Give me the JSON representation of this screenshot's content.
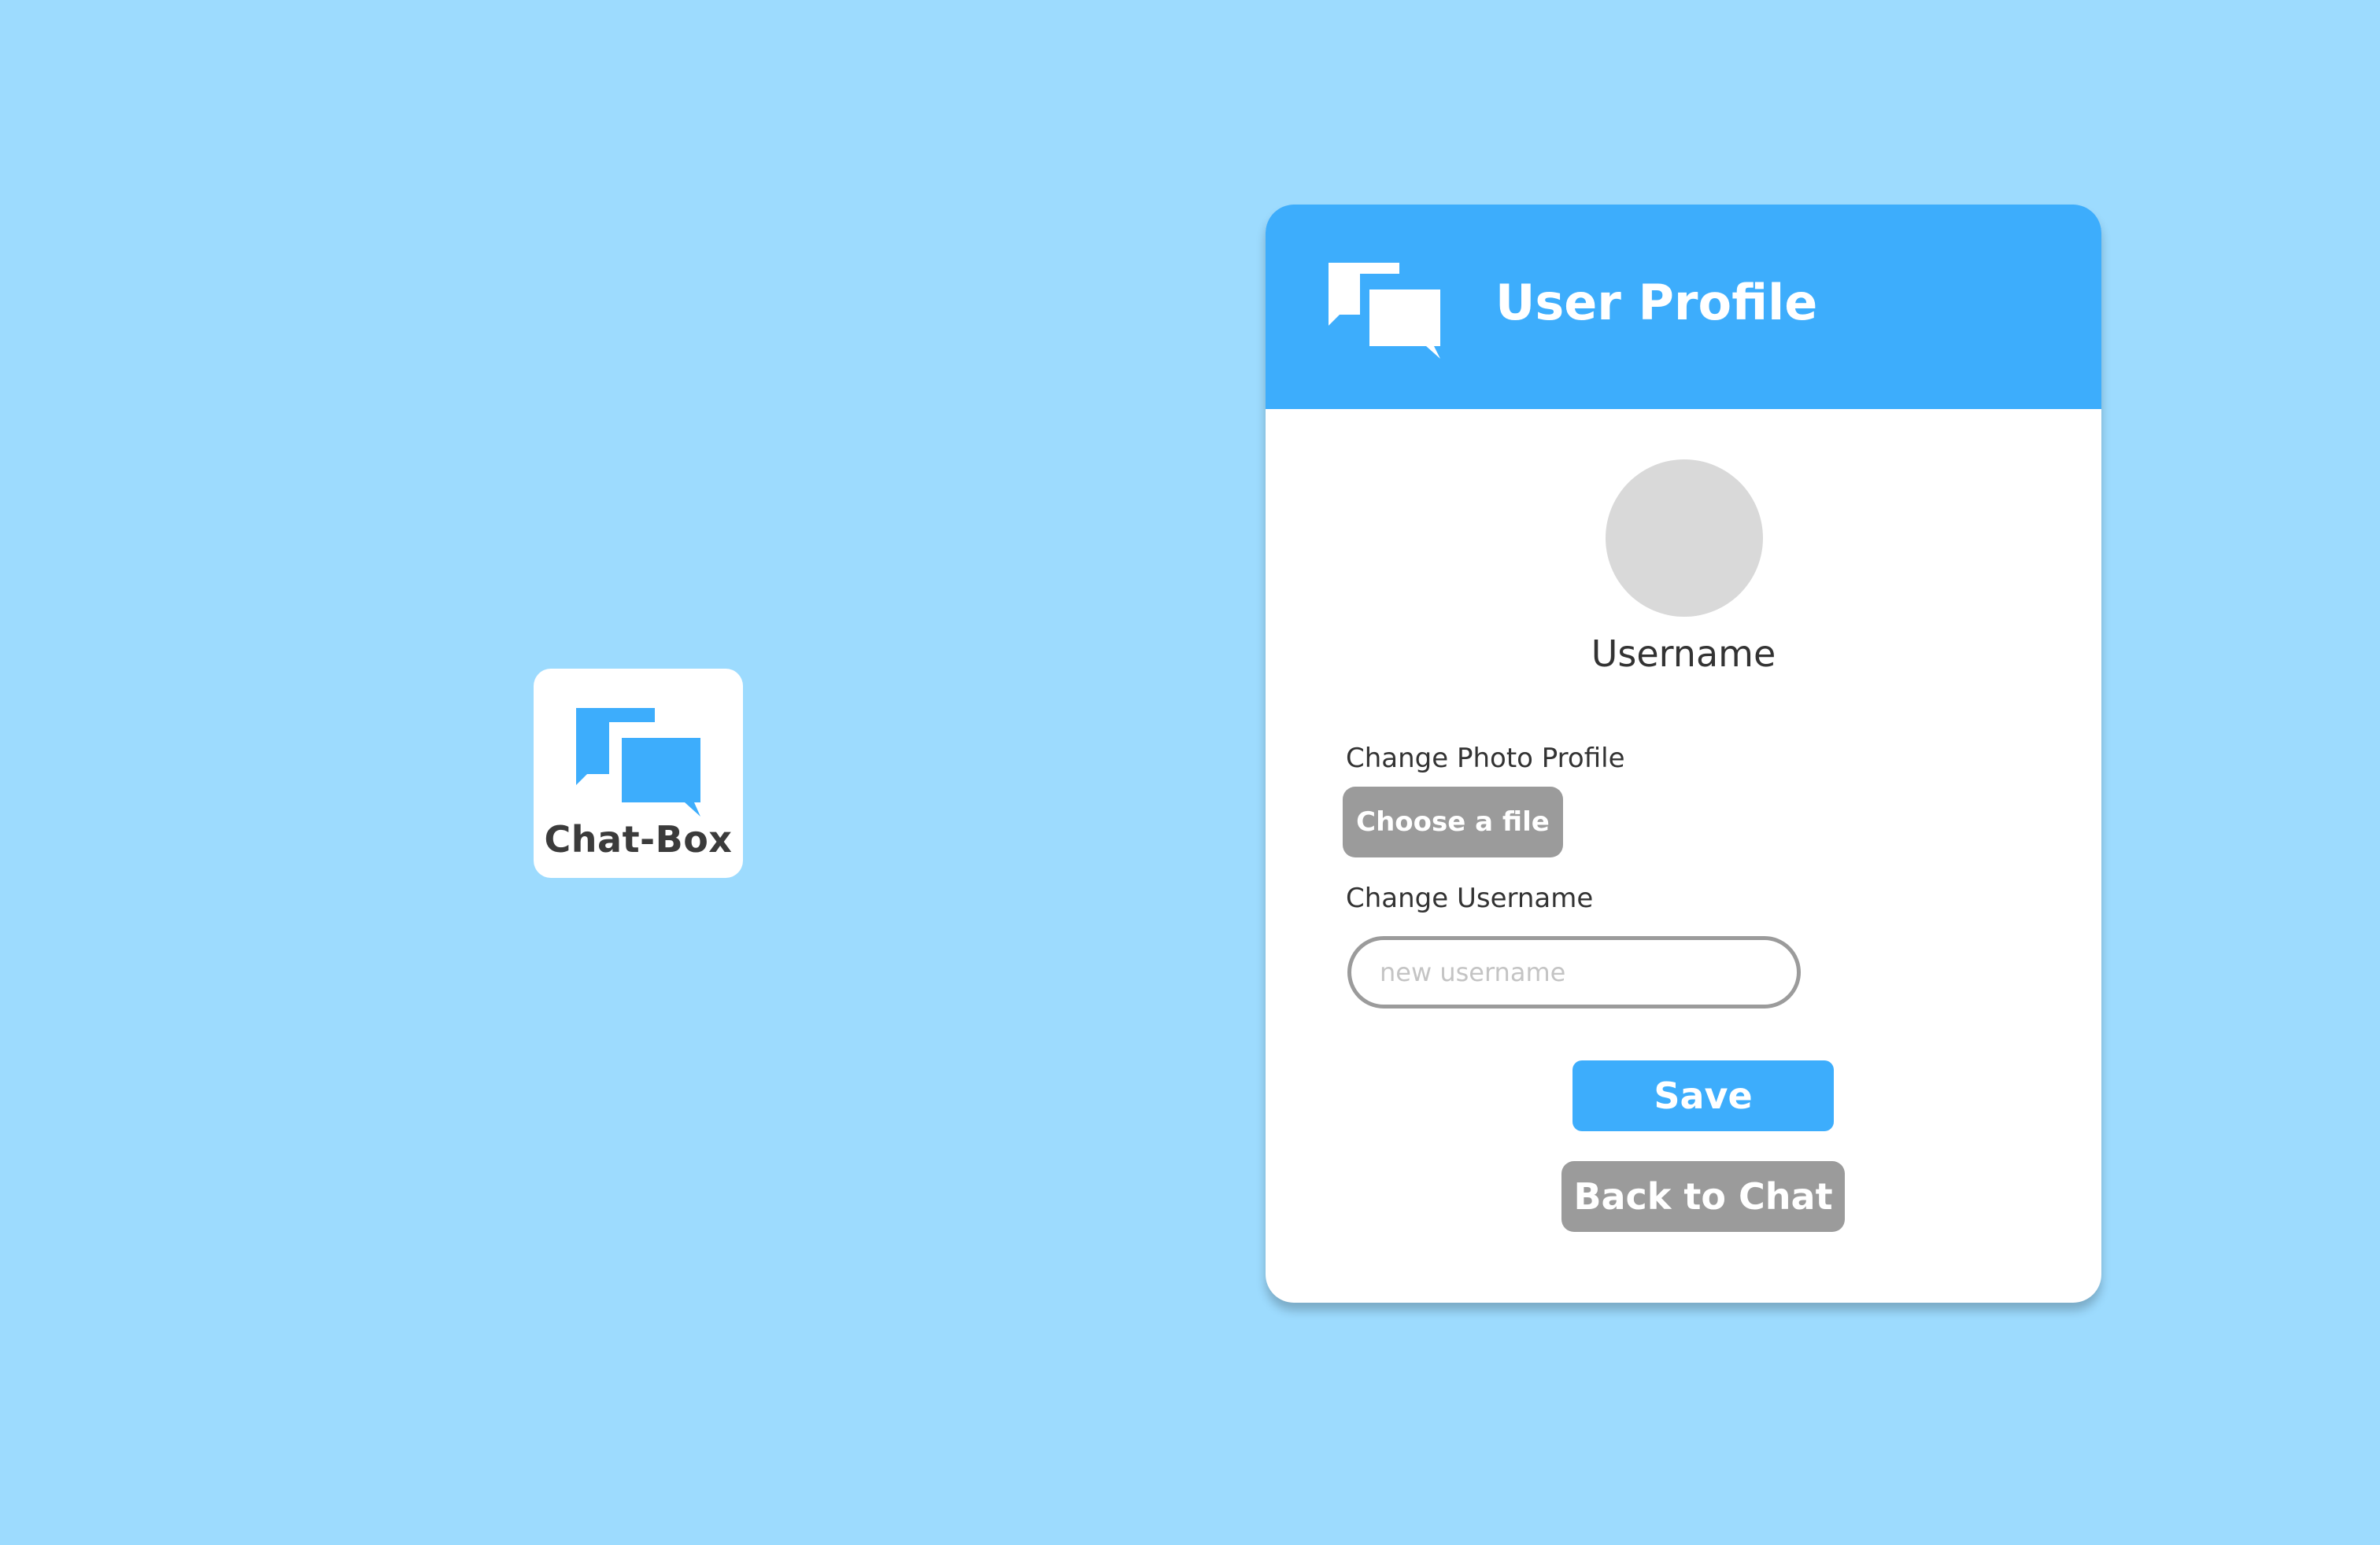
{
  "logo": {
    "label": "Chat-Box",
    "icon": "chat-bubbles-icon",
    "icon_color": "#3dadfc"
  },
  "profile_card": {
    "title": "User Profile",
    "header_icon": "chat-bubbles-icon",
    "username": "Username",
    "change_photo_label": "Change Photo Profile",
    "choose_file_label": "Choose a file",
    "change_username_label": "Change Username",
    "username_input": {
      "value": "",
      "placeholder": "new username"
    },
    "save_label": "Save",
    "back_label": "Back to Chat"
  },
  "colors": {
    "background": "#9ddbfe",
    "accent": "#3dadfc",
    "button_gray": "#9b9b9b",
    "avatar_placeholder": "#d9d9d9"
  }
}
